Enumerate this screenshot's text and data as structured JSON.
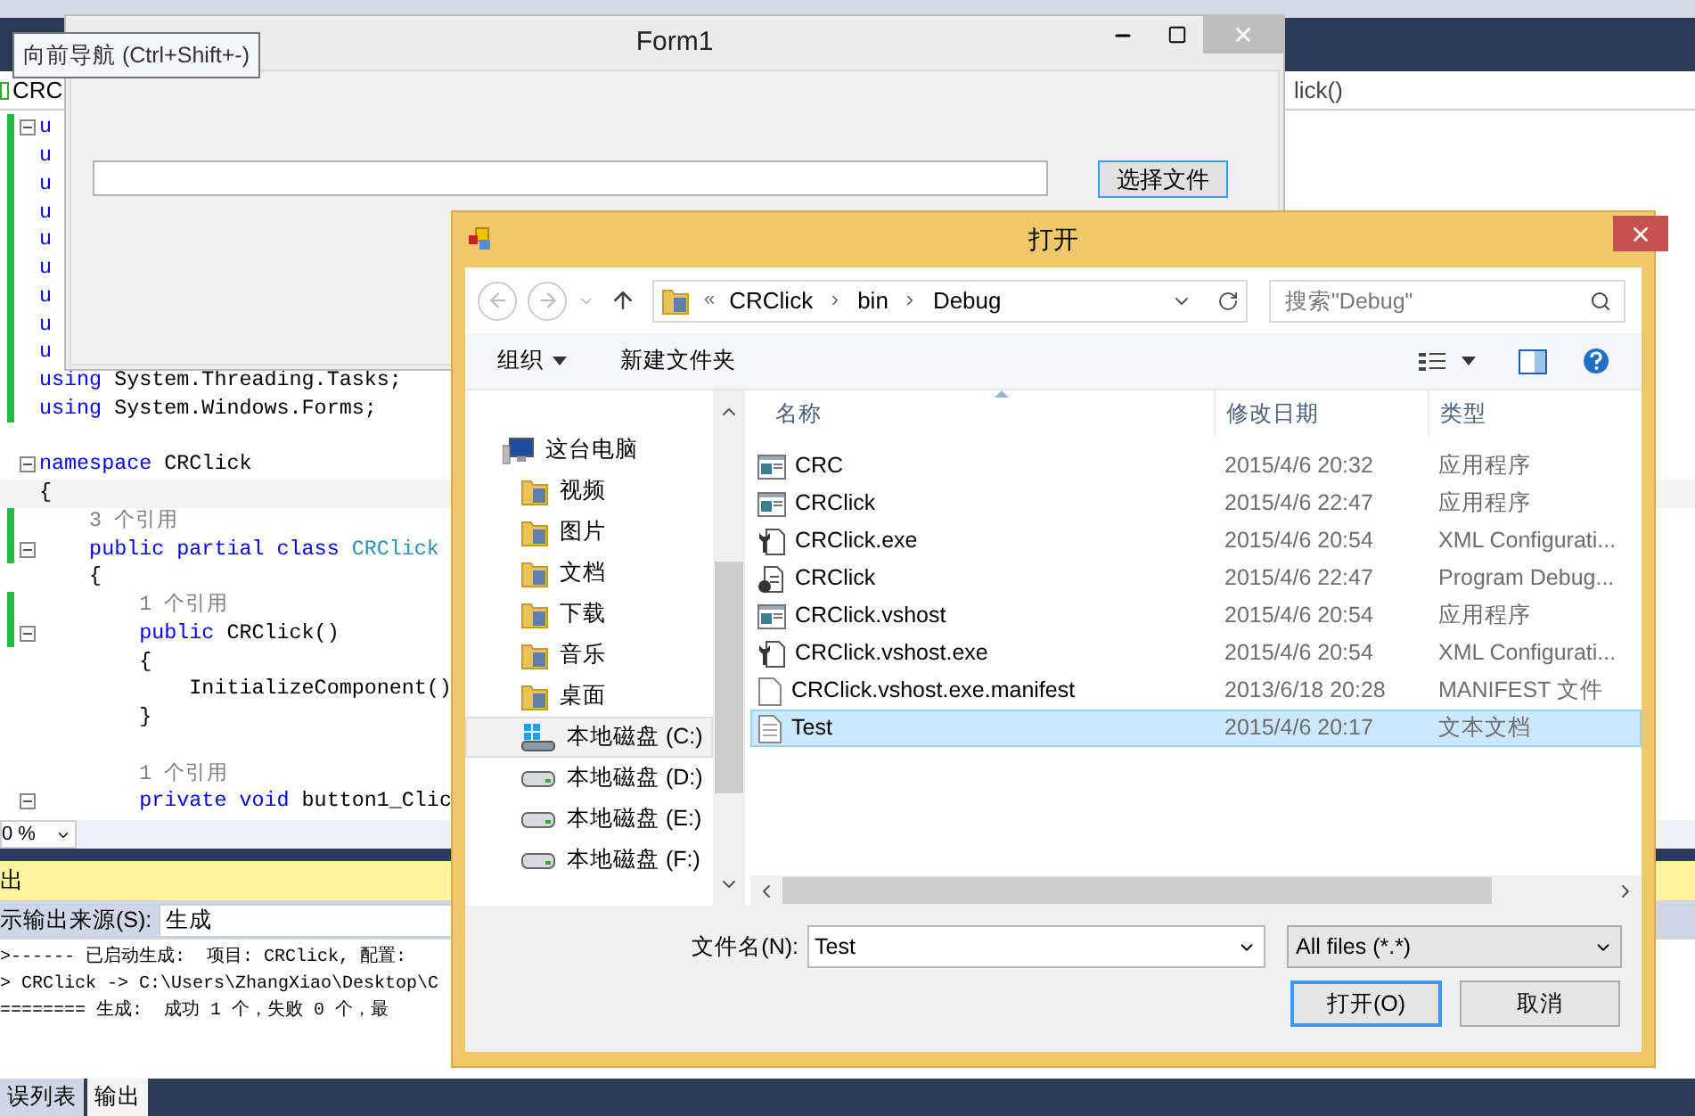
{
  "ide": {
    "nav_left": "CRC",
    "nav_right": "lick()",
    "code_lines": [
      {
        "kind": "code",
        "fold": true,
        "changed": true,
        "current": false,
        "segments": [
          {
            "kind": "keyword",
            "text": "u"
          }
        ]
      },
      {
        "kind": "code",
        "fold": false,
        "changed": true,
        "current": false,
        "segments": [
          {
            "kind": "keyword",
            "text": "u"
          }
        ]
      },
      {
        "kind": "code",
        "fold": false,
        "changed": true,
        "current": false,
        "segments": [
          {
            "kind": "keyword",
            "text": "u"
          }
        ]
      },
      {
        "kind": "code",
        "fold": false,
        "changed": true,
        "current": false,
        "segments": [
          {
            "kind": "keyword",
            "text": "u"
          }
        ]
      },
      {
        "kind": "code",
        "fold": false,
        "changed": true,
        "current": false,
        "segments": [
          {
            "kind": "keyword",
            "text": "u"
          }
        ]
      },
      {
        "kind": "code",
        "fold": false,
        "changed": true,
        "current": false,
        "segments": [
          {
            "kind": "keyword",
            "text": "u"
          }
        ]
      },
      {
        "kind": "code",
        "fold": false,
        "changed": true,
        "current": false,
        "segments": [
          {
            "kind": "keyword",
            "text": "u"
          }
        ]
      },
      {
        "kind": "code",
        "fold": false,
        "changed": true,
        "current": false,
        "segments": [
          {
            "kind": "keyword",
            "text": "u"
          }
        ]
      },
      {
        "kind": "code",
        "fold": false,
        "changed": true,
        "current": false,
        "segments": [
          {
            "kind": "keyword",
            "text": "u"
          }
        ]
      },
      {
        "kind": "code",
        "fold": false,
        "changed": true,
        "current": false,
        "segments": [
          {
            "kind": "keyword",
            "text": "using"
          },
          {
            "kind": "plain",
            "text": " System.Threading.Tasks;"
          }
        ]
      },
      {
        "kind": "code",
        "fold": false,
        "changed": true,
        "current": false,
        "segments": [
          {
            "kind": "keyword",
            "text": "using"
          },
          {
            "kind": "plain",
            "text": " System.Windows.Forms;"
          }
        ]
      },
      {
        "kind": "blank",
        "fold": false,
        "changed": false,
        "current": false
      },
      {
        "kind": "code",
        "fold": true,
        "changed": false,
        "current": false,
        "segments": [
          {
            "kind": "keyword",
            "text": "namespace"
          },
          {
            "kind": "plain",
            "text": " CRClick"
          }
        ]
      },
      {
        "kind": "code",
        "fold": false,
        "changed": false,
        "current": true,
        "segments": [
          {
            "kind": "plain",
            "text": "{"
          }
        ]
      },
      {
        "kind": "code",
        "fold": false,
        "changed": true,
        "current": false,
        "segments": [
          {
            "kind": "reference",
            "text": "    3 个引用"
          }
        ]
      },
      {
        "kind": "code",
        "fold": true,
        "changed": true,
        "current": false,
        "segments": [
          {
            "kind": "keyword",
            "text": "    public partial class"
          },
          {
            "kind": "type",
            "text": " CRClick"
          }
        ]
      },
      {
        "kind": "code",
        "fold": false,
        "changed": false,
        "current": false,
        "segments": [
          {
            "kind": "plain",
            "text": "    {"
          }
        ]
      },
      {
        "kind": "code",
        "fold": false,
        "changed": true,
        "current": false,
        "segments": [
          {
            "kind": "reference",
            "text": "        1 个引用"
          }
        ]
      },
      {
        "kind": "code",
        "fold": true,
        "changed": true,
        "current": false,
        "segments": [
          {
            "kind": "keyword",
            "text": "        public"
          },
          {
            "kind": "plain",
            "text": " CRClick()"
          }
        ]
      },
      {
        "kind": "code",
        "fold": false,
        "changed": false,
        "current": false,
        "segments": [
          {
            "kind": "plain",
            "text": "        {"
          }
        ]
      },
      {
        "kind": "code",
        "fold": false,
        "changed": false,
        "current": false,
        "segments": [
          {
            "kind": "plain",
            "text": "            InitializeComponent()"
          }
        ]
      },
      {
        "kind": "code",
        "fold": false,
        "changed": false,
        "current": false,
        "segments": [
          {
            "kind": "plain",
            "text": "        }"
          }
        ]
      },
      {
        "kind": "blank",
        "fold": false,
        "changed": false,
        "current": false
      },
      {
        "kind": "code",
        "fold": false,
        "changed": false,
        "current": false,
        "segments": [
          {
            "kind": "reference",
            "text": "        1 个引用"
          }
        ]
      },
      {
        "kind": "code",
        "fold": true,
        "changed": false,
        "current": false,
        "segments": [
          {
            "kind": "keyword",
            "text": "        private void"
          },
          {
            "kind": "plain",
            "text": " button1_Clic"
          }
        ]
      }
    ],
    "zoom": "0 %",
    "output": {
      "title": "出",
      "source_label": "示输出来源(S):",
      "source": "生成",
      "lines": [
        ">------ 已启动生成:  项目: CRClick, 配置:",
        "> CRClick -> C:\\Users\\ZhangXiao\\Desktop\\C",
        "======== 生成:  成功 1 个，失败 0 个，最"
      ]
    },
    "bottom_tabs": [
      {
        "label": "误列表",
        "selected": false
      },
      {
        "label": "输出",
        "selected": true
      }
    ]
  },
  "tooltip": "向前导航 (Ctrl+Shift+-)",
  "form1": {
    "title": "Form1",
    "button": "选择文件"
  },
  "dialog": {
    "title": "打开",
    "address_overflow": "«",
    "crumbs": [
      "CRClick",
      "bin",
      "Debug"
    ],
    "search_placeholder": "搜索\"Debug\"",
    "commands": [
      "组织",
      "新建文件夹"
    ],
    "nav": [
      {
        "label": "这台电脑",
        "kind": "computer",
        "selected": false,
        "children": [
          {
            "label": "视频",
            "kind": "folder",
            "selected": false
          },
          {
            "label": "图片",
            "kind": "folder",
            "selected": false
          },
          {
            "label": "文档",
            "kind": "folder",
            "selected": false
          },
          {
            "label": "下载",
            "kind": "folder",
            "selected": false
          },
          {
            "label": "音乐",
            "kind": "folder",
            "selected": false
          },
          {
            "label": "桌面",
            "kind": "folder",
            "selected": false
          },
          {
            "label": "本地磁盘 (C:)",
            "kind": "system-drive",
            "selected": true
          },
          {
            "label": "本地磁盘 (D:)",
            "kind": "drive",
            "selected": false
          },
          {
            "label": "本地磁盘 (E:)",
            "kind": "drive",
            "selected": false
          },
          {
            "label": "本地磁盘 (F:)",
            "kind": "drive",
            "selected": false
          }
        ]
      }
    ],
    "columns": [
      "名称",
      "修改日期",
      "类型"
    ],
    "files": [
      {
        "name": "CRC",
        "date": "2015/4/6 20:32",
        "type": "应用程序",
        "kind": "app",
        "selected": false
      },
      {
        "name": "CRClick",
        "date": "2015/4/6 22:47",
        "type": "应用程序",
        "kind": "app",
        "selected": false
      },
      {
        "name": "CRClick.exe",
        "date": "2015/4/6 20:54",
        "type": "XML Configurati...",
        "kind": "config",
        "selected": false
      },
      {
        "name": "CRClick",
        "date": "2015/4/6 22:47",
        "type": "Program Debug...",
        "kind": "debug",
        "selected": false
      },
      {
        "name": "CRClick.vshost",
        "date": "2015/4/6 20:54",
        "type": "应用程序",
        "kind": "app",
        "selected": false
      },
      {
        "name": "CRClick.vshost.exe",
        "date": "2015/4/6 20:54",
        "type": "XML Configurati...",
        "kind": "config",
        "selected": false
      },
      {
        "name": "CRClick.vshost.exe.manifest",
        "date": "2013/6/18 20:28",
        "type": "MANIFEST 文件",
        "kind": "blank",
        "selected": false
      },
      {
        "name": "Test",
        "date": "2015/4/6 20:17",
        "type": "文本文档",
        "kind": "text",
        "selected": true
      }
    ],
    "filename_label": "文件名(N):",
    "filename": "Test",
    "filter": "All files (*.*)",
    "buttons": [
      "打开(O)",
      "取消"
    ]
  }
}
